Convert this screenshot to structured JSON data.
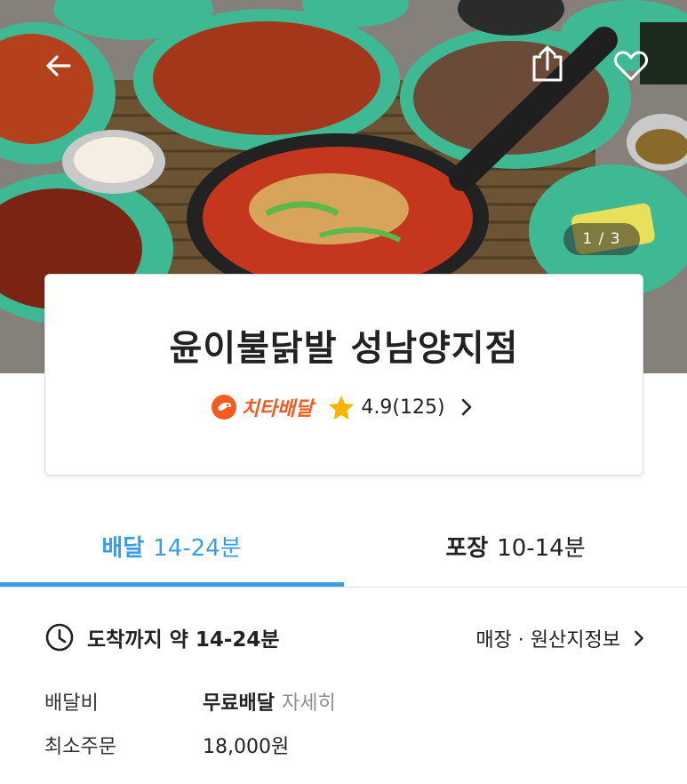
{
  "hero": {
    "pager_text": "1 / 3"
  },
  "store": {
    "name": "윤이불닭발 성남양지점",
    "delivery_brand": "치타배달",
    "rating": "4.9(125)"
  },
  "tabs": [
    {
      "bold": "배달",
      "time": "14-24분",
      "active": true
    },
    {
      "bold": "포장",
      "time": "10-14분",
      "active": false
    }
  ],
  "info": {
    "eta": "도착까지 약 14-24분",
    "store_info_link": "매장 · 원산지정보",
    "delivery_fee_label": "배달비",
    "delivery_fee_value": "무료배달",
    "delivery_fee_detail": "자세히",
    "min_order_label": "최소주문",
    "min_order_value": "18,000원"
  },
  "colors": {
    "accent": "#3a9ee6",
    "brand": "#f25c1f",
    "star": "#f7b500"
  },
  "icons": [
    "back-arrow-icon",
    "share-icon",
    "heart-icon",
    "cheetah-logo-icon",
    "star-icon",
    "chevron-right-icon",
    "clock-icon"
  ]
}
